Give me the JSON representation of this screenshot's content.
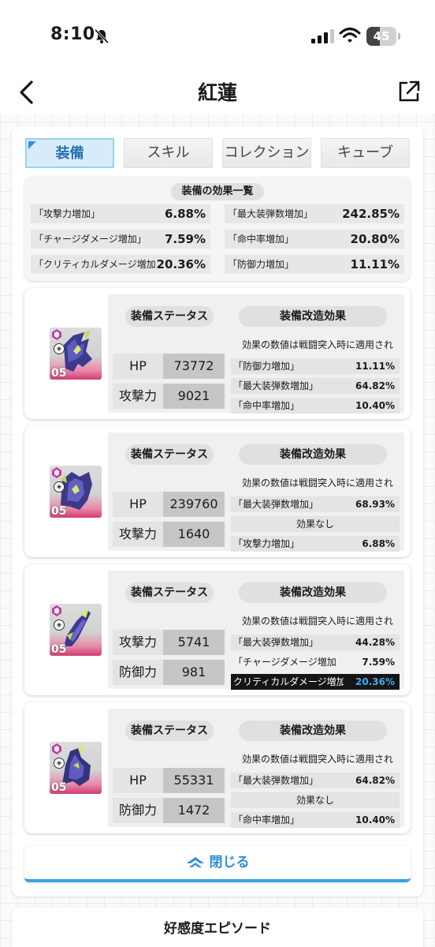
{
  "status_bar": {
    "time": "8:10",
    "battery": "45",
    "battery_level": 0.45
  },
  "nav": {
    "title": "紅蓮"
  },
  "tabs": [
    {
      "label": "装備",
      "active": true
    },
    {
      "label": "スキル",
      "active": false
    },
    {
      "label": "コレクション",
      "active": false
    },
    {
      "label": "キューブ",
      "active": false
    }
  ],
  "summary": {
    "title": "装備の効果一覧",
    "stats": [
      {
        "label": "「攻撃力増加」",
        "value": "6.88%"
      },
      {
        "label": "「最大装弾数増加」",
        "value": "242.85%"
      },
      {
        "label": "「チャージダメージ増加」",
        "value": "7.59%"
      },
      {
        "label": "「命中率増加」",
        "value": "20.80%"
      },
      {
        "label": "「クリティカルダメージ増加",
        "value": "20.36%"
      },
      {
        "label": "「防御力増加」",
        "value": "11.11%"
      }
    ]
  },
  "equipment": [
    {
      "level": "05",
      "status_header": "装備ステータス",
      "mod_header": "装備改造効果",
      "stats": [
        {
          "name": "HP",
          "value": "73772"
        },
        {
          "name": "攻撃力",
          "value": "9021"
        }
      ],
      "note": "効果の数値は戦闘突入時に適用され",
      "mods": [
        {
          "label": "「防御力増加」",
          "value": "11.11%"
        },
        {
          "label": "「最大装弾数増加」",
          "value": "64.82%"
        },
        {
          "label": "「命中率増加」",
          "value": "10.40%"
        }
      ]
    },
    {
      "level": "05",
      "status_header": "装備ステータス",
      "mod_header": "装備改造効果",
      "stats": [
        {
          "name": "HP",
          "value": "239760"
        },
        {
          "name": "攻撃力",
          "value": "1640"
        }
      ],
      "note": "効果の数値は戦闘突入時に適用され",
      "mods": [
        {
          "label": "「最大装弾数増加」",
          "value": "68.93%"
        },
        {
          "none": "効果なし"
        },
        {
          "label": "「攻撃力増加」",
          "value": "6.88%"
        }
      ]
    },
    {
      "level": "05",
      "status_header": "装備ステータス",
      "mod_header": "装備改造効果",
      "stats": [
        {
          "name": "攻撃力",
          "value": "5741"
        },
        {
          "name": "防御力",
          "value": "981"
        }
      ],
      "note": "効果の数値は戦闘突入時に適用され",
      "mods": [
        {
          "label": "「最大装弾数増加」",
          "value": "44.28%"
        },
        {
          "label": "「チャージダメージ増加",
          "value": "7.59%"
        },
        {
          "label": "クリティカルダメージ増加",
          "value": "20.36%",
          "highlight": true
        }
      ]
    },
    {
      "level": "05",
      "status_header": "装備ステータス",
      "mod_header": "装備改造効果",
      "stats": [
        {
          "name": "HP",
          "value": "55331"
        },
        {
          "name": "防御力",
          "value": "1472"
        }
      ],
      "note": "効果の数値は戦闘突入時に適用され",
      "mods": [
        {
          "label": "「最大装弾数増加」",
          "value": "64.82%"
        },
        {
          "none": "効果なし"
        },
        {
          "label": "「命中率増加」",
          "value": "10.40%"
        }
      ]
    }
  ],
  "close_button": {
    "label": "閉じる"
  },
  "bottom_section": {
    "title": "好感度エピソード"
  },
  "colors": {
    "accent": "#2f8fd6",
    "highlight_value": "#45a9ef",
    "rarity": "#d23a74"
  }
}
